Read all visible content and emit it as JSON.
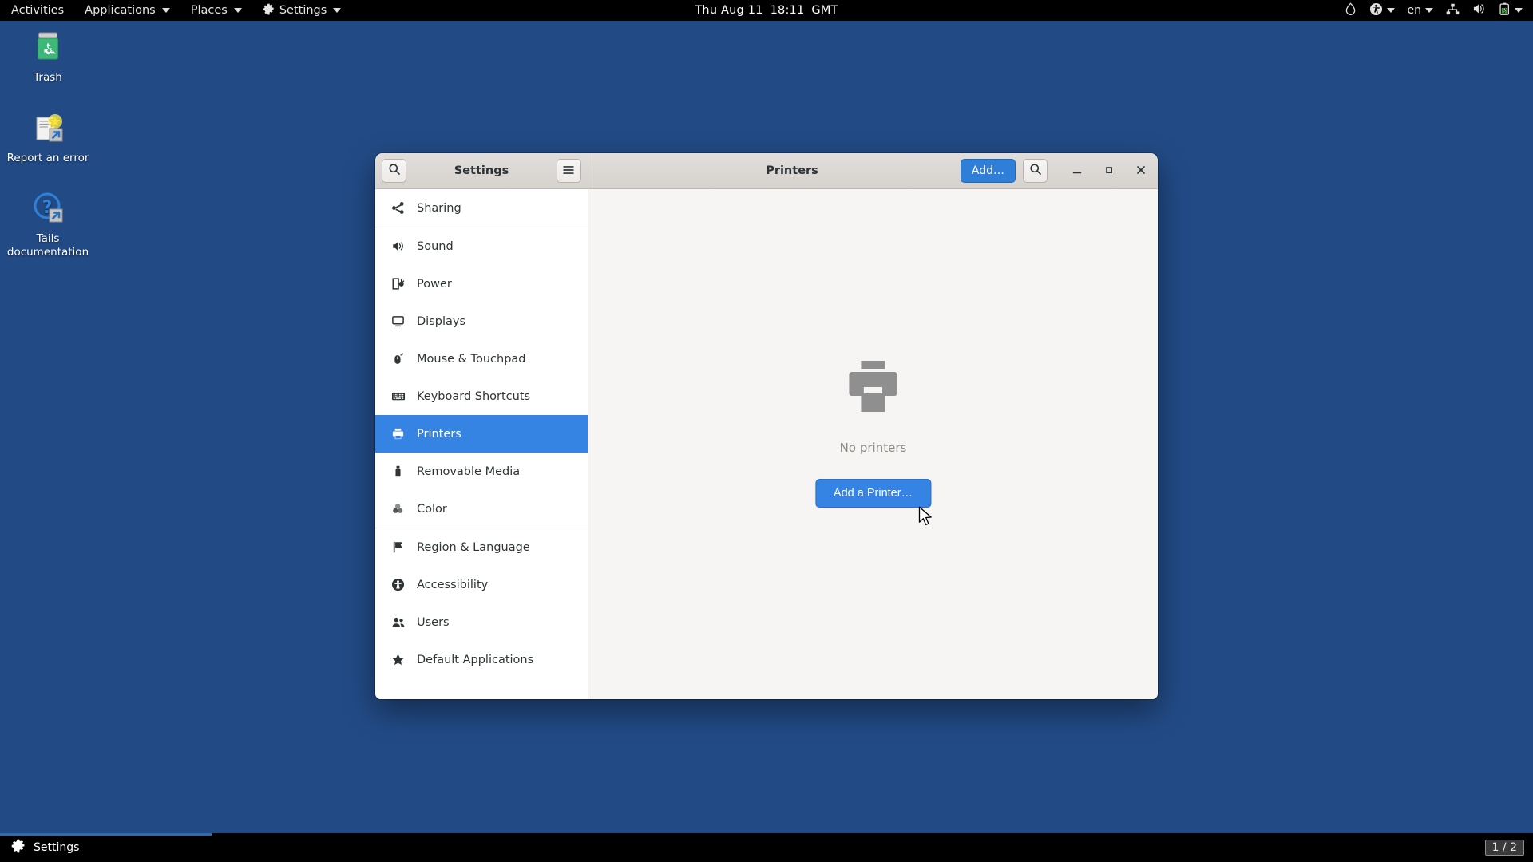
{
  "topbar": {
    "activities": "Activities",
    "applications": "Applications",
    "places": "Places",
    "settings": "Settings",
    "clock_date": "Thu Aug 11",
    "clock_time": "18:11",
    "clock_zone": "GMT",
    "language": "en",
    "icons": {
      "tor": "onion-droplet-icon",
      "accessibility": "accessibility-icon",
      "network": "network-wired-icon",
      "volume": "volume-icon",
      "battery": "battery-charging-icon"
    }
  },
  "desktop": {
    "background_color": "#224b86",
    "icons": [
      {
        "label": "Trash",
        "name": "trash"
      },
      {
        "label": "Report an error",
        "name": "report-an-error"
      },
      {
        "label": "Tails documentation",
        "name": "tails-documentation"
      }
    ]
  },
  "window": {
    "left_title": "Settings",
    "right_title": "Printers",
    "add_button": "Add…",
    "search_icon": "search-icon",
    "menu_icon": "hamburger-menu-icon",
    "minimize_icon": "minimize-icon",
    "maximize_icon": "maximize-icon",
    "close_icon": "close-icon",
    "accent_color": "#3584e4"
  },
  "sidebar": {
    "items": [
      {
        "label": "Sharing",
        "icon": "share-icon",
        "selected": false,
        "sep_after": true
      },
      {
        "label": "Sound",
        "icon": "speaker-icon",
        "selected": false,
        "sep_after": false
      },
      {
        "label": "Power",
        "icon": "power-plug-icon",
        "selected": false,
        "sep_after": false
      },
      {
        "label": "Displays",
        "icon": "monitor-icon",
        "selected": false,
        "sep_after": false
      },
      {
        "label": "Mouse & Touchpad",
        "icon": "mouse-icon",
        "selected": false,
        "sep_after": false
      },
      {
        "label": "Keyboard Shortcuts",
        "icon": "keyboard-icon",
        "selected": false,
        "sep_after": false
      },
      {
        "label": "Printers",
        "icon": "printer-icon",
        "selected": true,
        "sep_after": false
      },
      {
        "label": "Removable Media",
        "icon": "usb-drive-icon",
        "selected": false,
        "sep_after": false
      },
      {
        "label": "Color",
        "icon": "color-icon",
        "selected": false,
        "sep_after": true
      },
      {
        "label": "Region & Language",
        "icon": "flag-icon",
        "selected": false,
        "sep_after": false
      },
      {
        "label": "Accessibility",
        "icon": "accessibility-icon",
        "selected": false,
        "sep_after": false
      },
      {
        "label": "Users",
        "icon": "users-icon",
        "selected": false,
        "sep_after": false
      },
      {
        "label": "Default Applications",
        "icon": "star-icon",
        "selected": false,
        "sep_after": false
      }
    ]
  },
  "content": {
    "empty_icon": "printer-large-icon",
    "empty_text": "No printers",
    "add_printer_button": "Add a Printer…"
  },
  "taskbar": {
    "task_label": "Settings",
    "task_icon": "gear-icon",
    "workspace": "1 / 2"
  }
}
